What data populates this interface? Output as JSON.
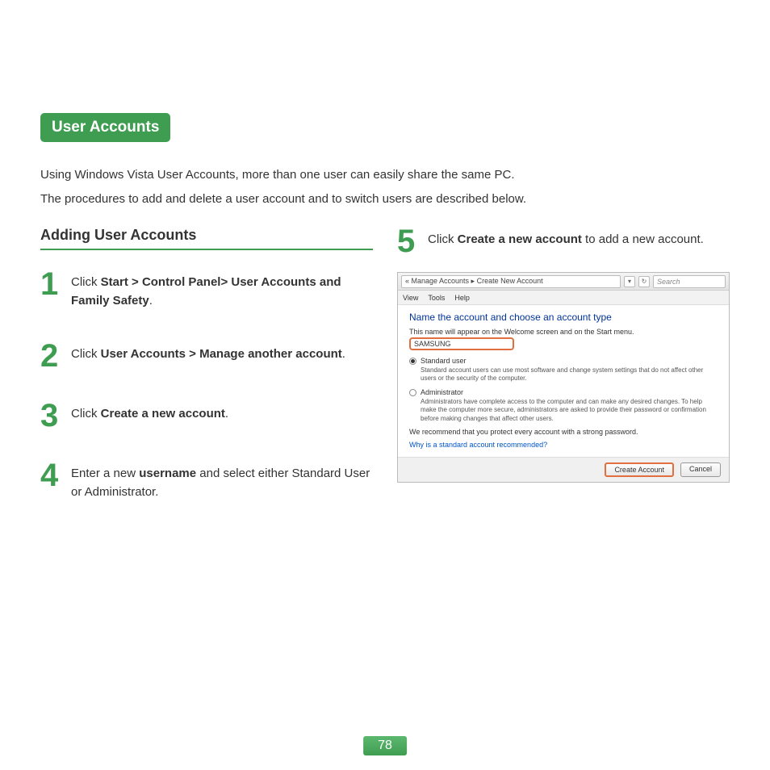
{
  "title": "User Accounts",
  "intro": {
    "line1": "Using Windows Vista User Accounts, more than one user can easily share the same PC.",
    "line2": "The procedures to add and delete a user account and to switch users are described below."
  },
  "subheading": "Adding User Accounts",
  "steps": {
    "s1": {
      "num": "1",
      "pre": "Click ",
      "b": "Start > Control Panel> User Accounts and Family Safety",
      "post": "."
    },
    "s2": {
      "num": "2",
      "pre": "Click ",
      "b": "User Accounts > Manage another account",
      "post": "."
    },
    "s3": {
      "num": "3",
      "pre": "Click ",
      "b": "Create a new account",
      "post": "."
    },
    "s4": {
      "num": "4",
      "pre": "Enter a new ",
      "b": "username",
      "post": " and select either Standard User or Administrator."
    },
    "s5": {
      "num": "5",
      "pre": "Click ",
      "b": "Create a new account",
      "post": " to add a new account."
    }
  },
  "dialog": {
    "breadcrumb": "« Manage Accounts  ▸  Create New Account",
    "search_placeholder": "Search",
    "menu": {
      "view": "View",
      "tools": "Tools",
      "help": "Help"
    },
    "heading": "Name the account and choose an account type",
    "sub": "This name will appear on the Welcome screen and on the Start menu.",
    "input_value": "SAMSUNG",
    "opt1_label": "Standard user",
    "opt1_desc": "Standard account users can use most software and change system settings that do not affect other users or the security of the computer.",
    "opt2_label": "Administrator",
    "opt2_desc": "Administrators have complete access to the computer and can make any desired changes. To help make the computer more secure, administrators are asked to provide their password or confirmation before making changes that affect other users.",
    "recommend": "We recommend that you protect every account with a strong password.",
    "link": "Why is a standard account recommended?",
    "btn_create": "Create Account",
    "btn_cancel": "Cancel"
  },
  "page_number": "78"
}
